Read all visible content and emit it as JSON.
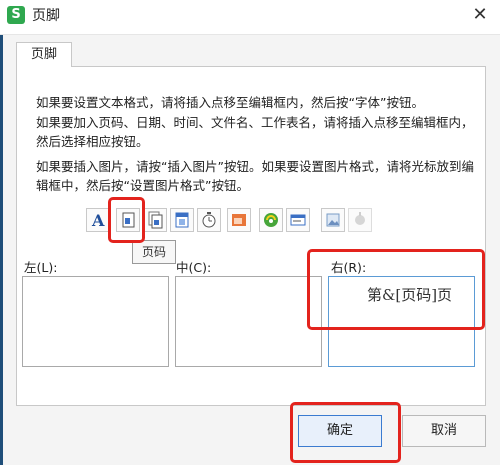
{
  "window": {
    "app_icon_letter": "S",
    "title": "页脚",
    "close_glyph": "✕"
  },
  "tab": {
    "label": "页脚"
  },
  "instructions": [
    "如果要设置文本格式，请将插入点移至编辑框内，然后按“字体”按钮。",
    "如果要加入页码、日期、时间、文件名、工作表名，请将插入点移至编辑框内，然后选择相应按钮。",
    "如果要插入图片，请按“插入图片”按钮。如果要设置图片格式，请将光标放到编辑框中，然后按“设置图片格式”按钮。"
  ],
  "toolbar": {
    "font_glyph": "A",
    "buttons": [
      "font-icon",
      "page-number-icon",
      "page-count-icon",
      "date-icon",
      "time-icon",
      "file-name-icon",
      "sheet-name-icon",
      "file-path-icon",
      "insert-picture-icon",
      "format-picture-icon"
    ]
  },
  "tooltip": {
    "text": "页码"
  },
  "sections": {
    "left_label": "左(L):",
    "center_label": "中(C):",
    "right_label": "右(R):",
    "right_content": "第&[页码]页"
  },
  "buttons": {
    "ok": "确定",
    "cancel": "取消"
  },
  "colors": {
    "annotation": "#e3231d",
    "app_icon": "#2fa84f",
    "focus_border": "#5b9bd5"
  }
}
